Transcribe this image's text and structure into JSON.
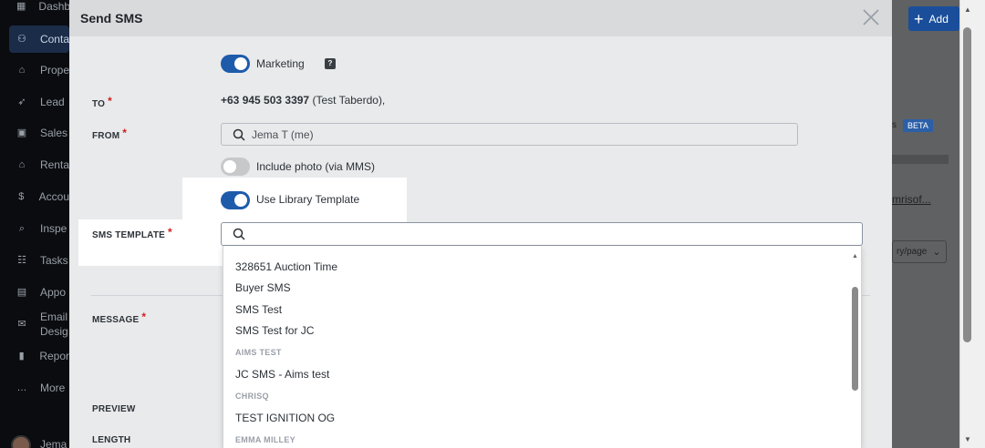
{
  "sidebar": {
    "items": [
      {
        "label": "Dashb",
        "icon": "grid-icon"
      },
      {
        "label": "Conta",
        "icon": "person-icon"
      },
      {
        "label": "Prope",
        "icon": "home-icon"
      },
      {
        "label": "Lead",
        "icon": "rocket-icon"
      },
      {
        "label": "Sales",
        "icon": "store-icon"
      },
      {
        "label": "Renta",
        "icon": "home-key-icon"
      },
      {
        "label": "Accou",
        "icon": "dollar-icon"
      },
      {
        "label": "Inspe",
        "icon": "inspect-icon"
      },
      {
        "label": "Tasks",
        "icon": "tasks-icon"
      },
      {
        "label": "Appo",
        "icon": "calendar-icon"
      },
      {
        "label": "Email Desig",
        "icon": "mail-icon"
      },
      {
        "label": "Repor",
        "icon": "bar-chart-icon"
      },
      {
        "label": "More",
        "icon": "dots-icon"
      }
    ],
    "user": "Jema"
  },
  "background": {
    "add_label": "Add",
    "beta_label": "BETA",
    "partial_s": "s",
    "link_text": "mrisof...",
    "per_page": "ry/page"
  },
  "modal": {
    "title": "Send SMS",
    "marketing_label": "Marketing",
    "to_label": "TO",
    "to_number": "+63 945 503 3397",
    "to_name": "(Test Taberdo),",
    "from_label": "FROM",
    "from_value": "Jema T (me)",
    "include_photo_label": "Include photo (via MMS)",
    "library_template_label": "Use Library Template",
    "sms_template_label": "SMS TEMPLATE",
    "template_search_value": "",
    "message_label": "MESSAGE",
    "preview_label": "PREVIEW",
    "length_label": "LENGTH",
    "required_mark": "*"
  },
  "toggles": {
    "marketing": true,
    "include_photo": false,
    "library_template": true
  },
  "dropdown": {
    "items": [
      {
        "kind": "option",
        "label": "328651 Auction Time"
      },
      {
        "kind": "option",
        "label": "Buyer SMS"
      },
      {
        "kind": "option",
        "label": "SMS Test"
      },
      {
        "kind": "option",
        "label": "SMS Test for JC"
      },
      {
        "kind": "group",
        "label": "AIMS TEST"
      },
      {
        "kind": "option",
        "label": "JC SMS - Aims test"
      },
      {
        "kind": "group",
        "label": "CHRISQ"
      },
      {
        "kind": "option",
        "label": "TEST IGNITION OG"
      },
      {
        "kind": "group",
        "label": "EMMA MILLEY"
      }
    ]
  },
  "colors": {
    "accent": "#1e5bab",
    "required": "#d11f1f",
    "modal_bg": "#e9eaeb",
    "sidebar_bg": "#0a0c10"
  }
}
